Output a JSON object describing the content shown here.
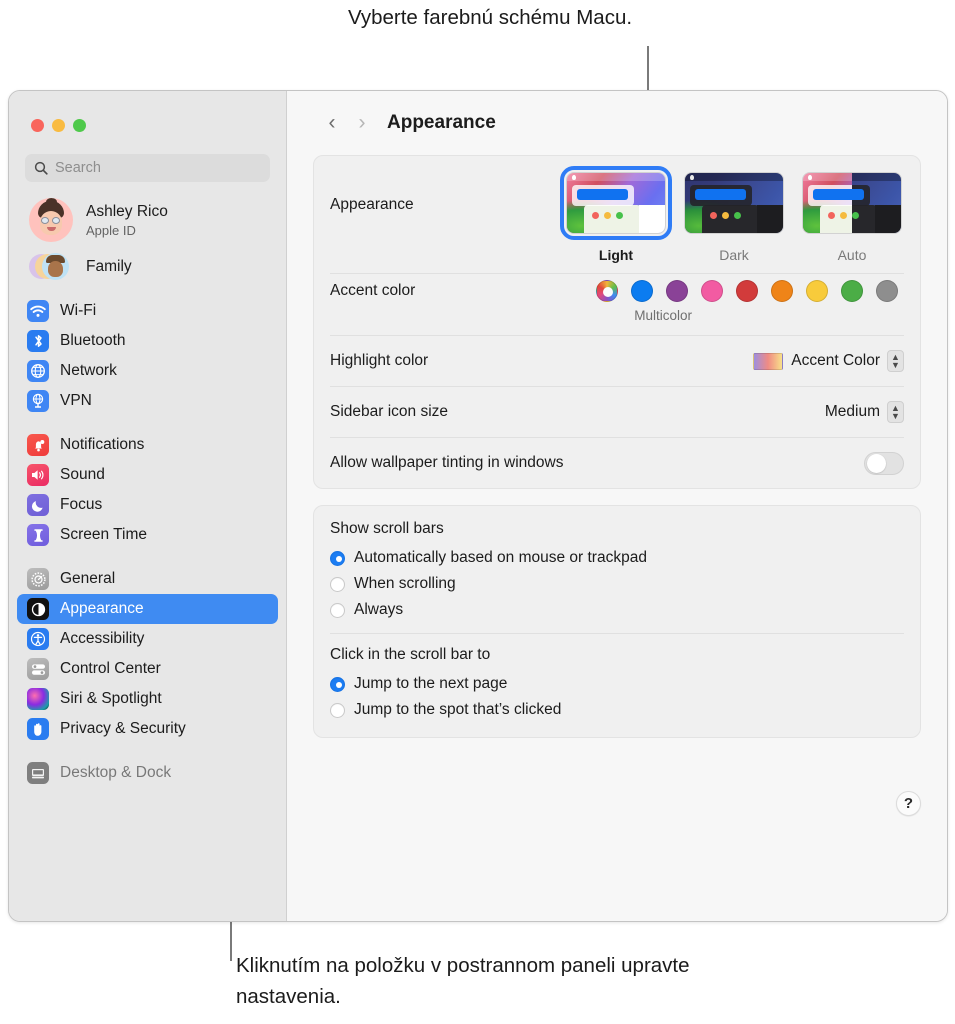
{
  "callouts": {
    "top": "Vyberte farebnú schému Macu.",
    "bottom": "Kliknutím na položku v postrannom paneli upravte nastavenia."
  },
  "sidebar": {
    "search": {
      "placeholder": "Search",
      "icon": "search-icon"
    },
    "account": {
      "name": "Ashley Rico",
      "subtitle": "Apple ID",
      "avatar": "memoji-avatar"
    },
    "family": {
      "label": "Family",
      "icon": "family-avatars"
    },
    "groups": [
      {
        "items": [
          {
            "label": "Wi-Fi",
            "icon": "wifi-icon"
          },
          {
            "label": "Bluetooth",
            "icon": "bluetooth-icon"
          },
          {
            "label": "Network",
            "icon": "network-globe-icon"
          },
          {
            "label": "VPN",
            "icon": "vpn-icon"
          }
        ]
      },
      {
        "items": [
          {
            "label": "Notifications",
            "icon": "notifications-bell-icon"
          },
          {
            "label": "Sound",
            "icon": "sound-speaker-icon"
          },
          {
            "label": "Focus",
            "icon": "focus-moon-icon"
          },
          {
            "label": "Screen Time",
            "icon": "screen-time-hourglass-icon"
          }
        ]
      },
      {
        "items": [
          {
            "label": "General",
            "icon": "general-gear-icon"
          },
          {
            "label": "Appearance",
            "icon": "appearance-contrast-icon",
            "selected": true
          },
          {
            "label": "Accessibility",
            "icon": "accessibility-icon"
          },
          {
            "label": "Control Center",
            "icon": "control-center-icon"
          },
          {
            "label": "Siri & Spotlight",
            "icon": "siri-icon"
          },
          {
            "label": "Privacy & Security",
            "icon": "privacy-hand-icon"
          }
        ]
      },
      {
        "items": [
          {
            "label": "Desktop & Dock",
            "icon": "desktop-dock-icon",
            "cut_off": true
          }
        ]
      }
    ]
  },
  "toolbar": {
    "back_icon": "chevron-left-icon",
    "forward_icon": "chevron-right-icon",
    "title": "Appearance"
  },
  "main": {
    "appearance": {
      "label": "Appearance",
      "options": [
        {
          "label": "Light",
          "selected": true
        },
        {
          "label": "Dark",
          "selected": false
        },
        {
          "label": "Auto",
          "selected": false
        }
      ]
    },
    "accent_color": {
      "label": "Accent color",
      "selected_label": "Multicolor",
      "swatches": [
        {
          "name": "Multicolor",
          "color": "multicolor",
          "selected": true
        },
        {
          "name": "Blue",
          "color": "#0b7cf0"
        },
        {
          "name": "Purple",
          "color": "#8a4297"
        },
        {
          "name": "Pink",
          "color": "#f25ba2"
        },
        {
          "name": "Red",
          "color": "#d23b3b"
        },
        {
          "name": "Orange",
          "color": "#ef8418"
        },
        {
          "name": "Yellow",
          "color": "#f8cb3b"
        },
        {
          "name": "Green",
          "color": "#4bad46"
        },
        {
          "name": "Graphite",
          "color": "#8e8e8e"
        }
      ]
    },
    "highlight_color": {
      "label": "Highlight color",
      "value": "Accent Color",
      "swatch_gradient": "#9d8fe0,#f08b84,#f8e08a",
      "control": "popup-menu"
    },
    "sidebar_icon_size": {
      "label": "Sidebar icon size",
      "value": "Medium",
      "control": "popup-menu"
    },
    "wallpaper_tinting": {
      "label": "Allow wallpaper tinting in windows",
      "value": "off",
      "control": "toggle-switch"
    },
    "scroll_bars": {
      "title": "Show scroll bars",
      "options": [
        {
          "label": "Automatically based on mouse or trackpad",
          "selected": true
        },
        {
          "label": "When scrolling",
          "selected": false
        },
        {
          "label": "Always",
          "selected": false
        }
      ]
    },
    "scroll_click": {
      "title": "Click in the scroll bar to",
      "options": [
        {
          "label": "Jump to the next page",
          "selected": true
        },
        {
          "label": "Jump to the spot that’s clicked",
          "selected": false
        }
      ]
    },
    "help_button": "?"
  },
  "window_controls": {
    "close": "close-button",
    "minimize": "minimize-button",
    "zoom": "zoom-button"
  },
  "colors": {
    "accent_blue": "#3f8bf2",
    "selection_blue": "#1c7df3",
    "sidebar_bg": "#e7e7e7",
    "content_bg": "#f7f7f7",
    "card_bg": "#f0f0f0"
  }
}
